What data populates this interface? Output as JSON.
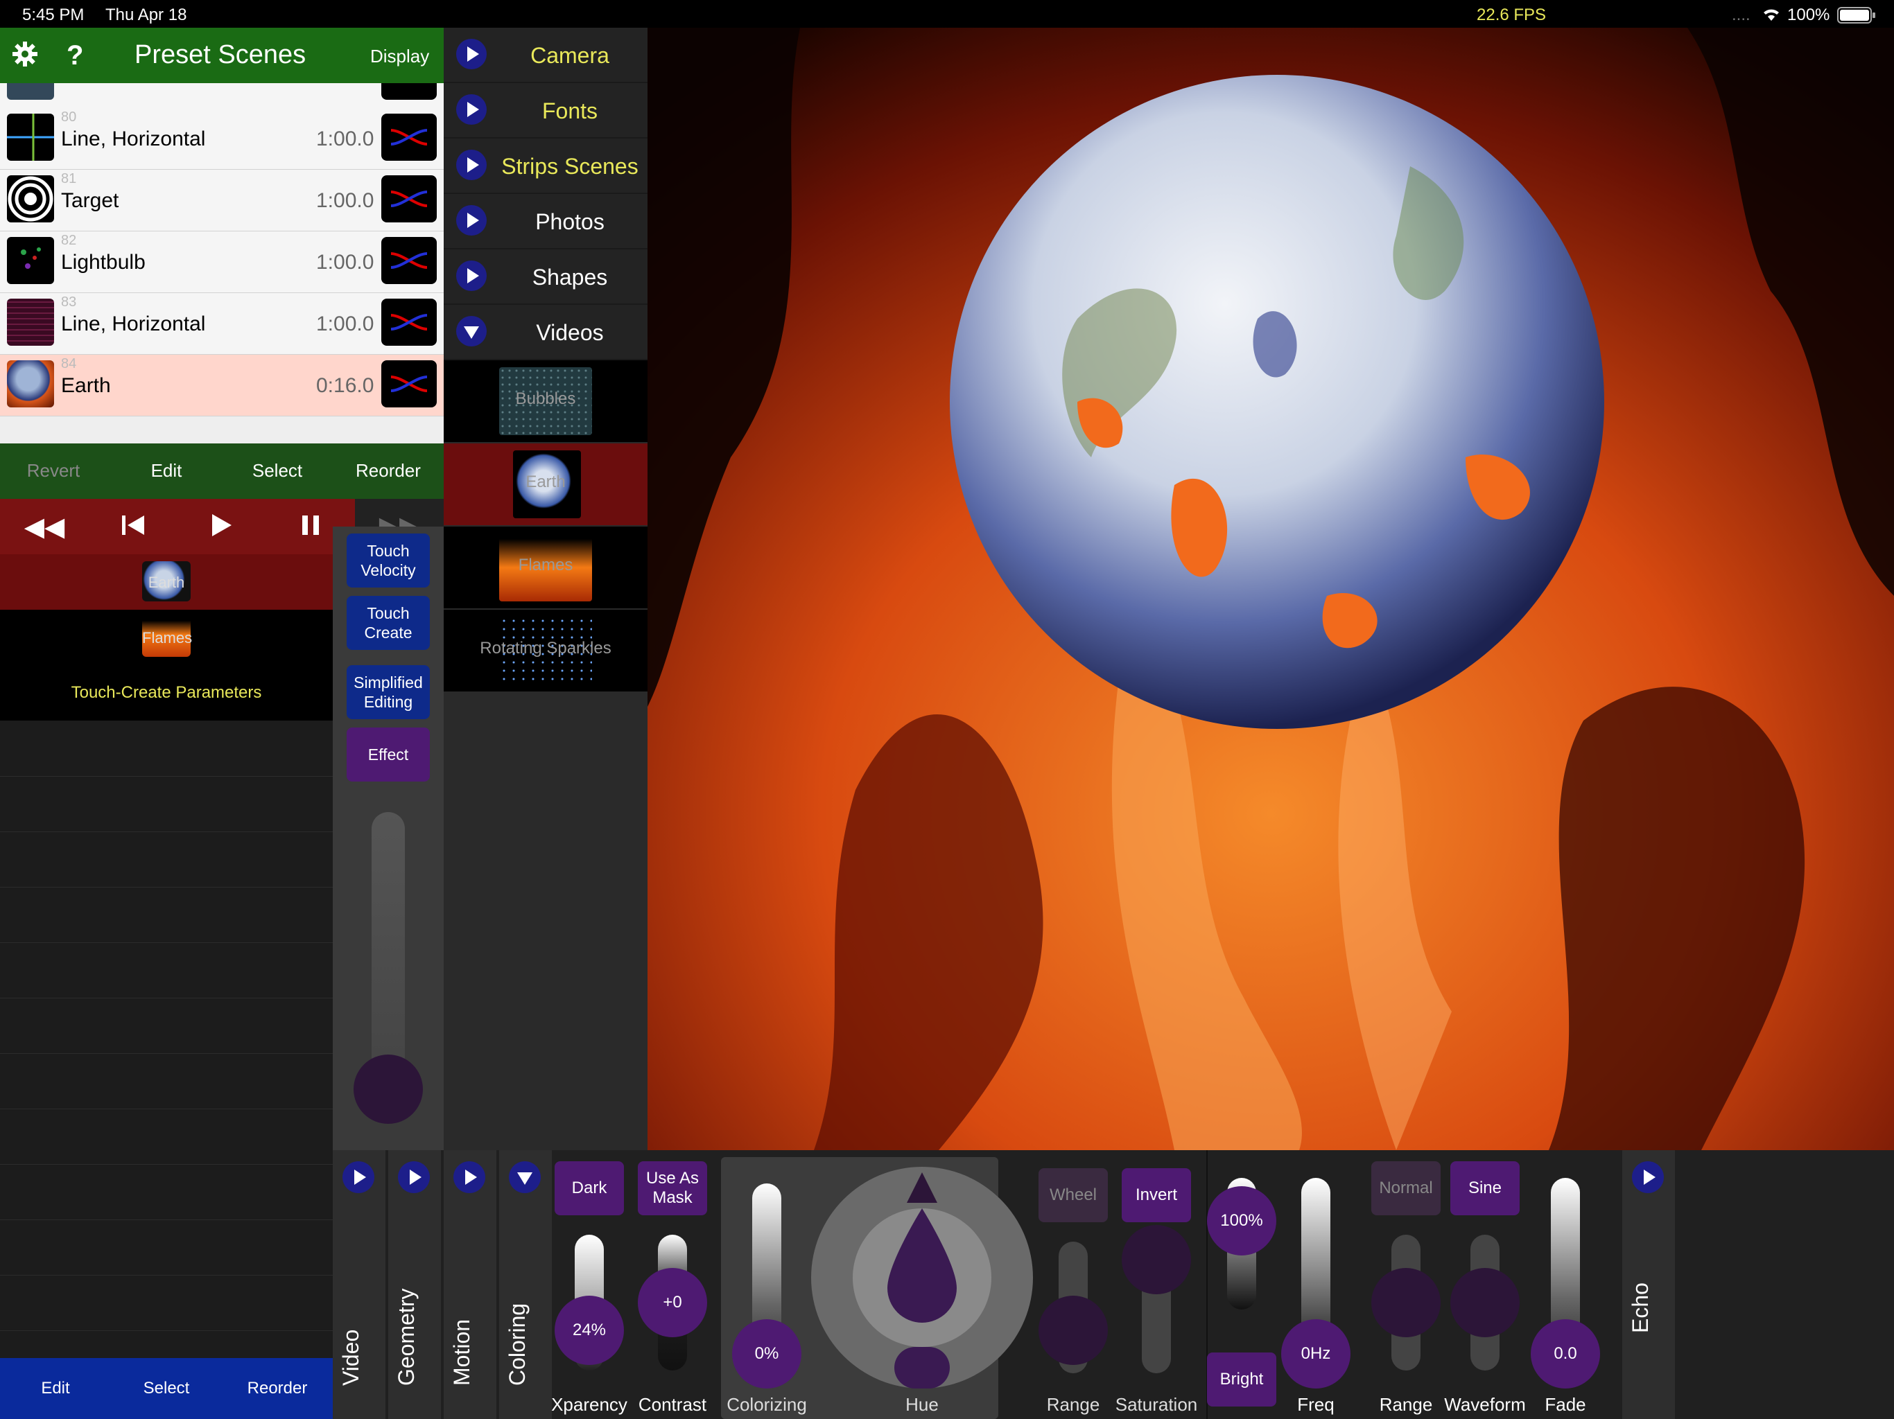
{
  "status": {
    "time": "5:45 PM",
    "date": "Thu Apr 18",
    "fps": "22.6 FPS",
    "signal": "....",
    "battery": "100%"
  },
  "header": {
    "title": "Preset Scenes",
    "display_label": "Display"
  },
  "presets": [
    {
      "num": "80",
      "name": "Line, Horizontal",
      "duration": "1:00.0"
    },
    {
      "num": "81",
      "name": "Target",
      "duration": "1:00.0"
    },
    {
      "num": "82",
      "name": "Lightbulb",
      "duration": "1:00.0"
    },
    {
      "num": "83",
      "name": "Line, Horizontal",
      "duration": "1:00.0"
    },
    {
      "num": "84",
      "name": "Earth",
      "duration": "0:16.0"
    }
  ],
  "preset_bar": {
    "revert": "Revert",
    "edit": "Edit",
    "select": "Select",
    "reorder": "Reorder"
  },
  "layers": {
    "earth": "Earth",
    "flames": "Flames",
    "touch_create_params": "Touch-Create Parameters"
  },
  "side_buttons": {
    "touch_velocity": "Touch Velocity",
    "touch_create": "Touch Create",
    "simplified_editing": "Simplified Editing",
    "effect": "Effect"
  },
  "bottom_bar": {
    "edit": "Edit",
    "select": "Select",
    "reorder": "Reorder"
  },
  "categories": [
    "Camera",
    "Fonts",
    "Strips Scenes",
    "Photos",
    "Shapes",
    "Videos"
  ],
  "videos": [
    "Bubbles",
    "Earth",
    "Flames",
    "Rotating Sparkles"
  ],
  "control_tabs": {
    "video": "Video",
    "geometry": "Geometry",
    "motion": "Motion",
    "coloring": "Coloring",
    "echo": "Echo"
  },
  "params": {
    "dark": "Dark",
    "use_as_mask": "Use As Mask",
    "xparency_value": "24%",
    "xparency_label": "Xparency",
    "contrast_value": "+0",
    "contrast_label": "Contrast",
    "colorizing_value": "0%",
    "colorizing_label": "Colorizing",
    "hue_label": "Hue",
    "wheel": "Wheel",
    "invert": "Invert",
    "range_label": "Range",
    "saturation_label": "Saturation",
    "bright_value": "100%",
    "bright_label": "Bright",
    "freq_value": "0Hz",
    "freq_label": "Freq",
    "normal": "Normal",
    "sine": "Sine",
    "range2_label": "Range",
    "waveform_label": "Waveform",
    "fade_value": "0.0",
    "fade_label": "Fade"
  },
  "colors": {
    "header_green": "#1a6b14",
    "transport_red": "#7a1212",
    "purple": "#4e1a72",
    "blue": "#1d1e8a",
    "accent_yellow": "#e9e85a"
  }
}
